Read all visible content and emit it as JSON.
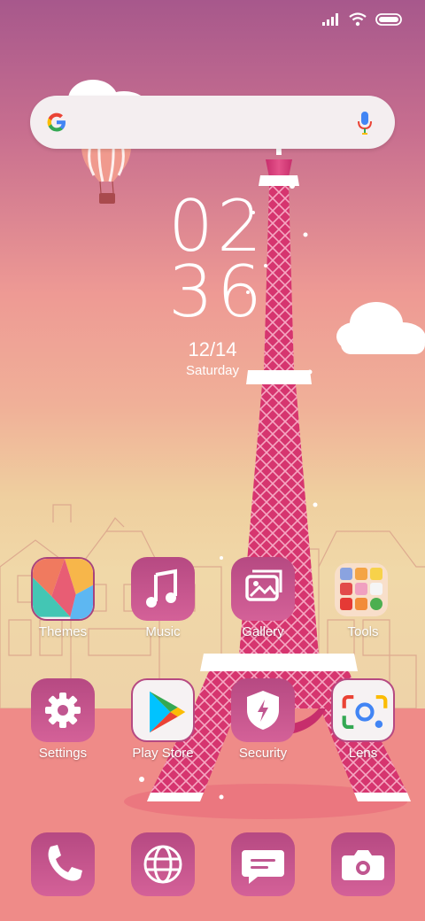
{
  "clock": {
    "hours": "02",
    "minutes": "36",
    "date": "12/14",
    "weekday": "Saturday"
  },
  "search": {
    "provider_icon": "google-g-icon",
    "voice_icon": "mic-icon"
  },
  "status_bar": {
    "icons": [
      "signal-icon",
      "wifi-icon",
      "battery-icon"
    ]
  },
  "apps_row1": [
    {
      "label": "Themes",
      "icon": "themes-icon"
    },
    {
      "label": "Music",
      "icon": "music-note-icon"
    },
    {
      "label": "Gallery",
      "icon": "gallery-icon"
    },
    {
      "label": "Tools",
      "icon": "folder-icon"
    }
  ],
  "apps_row2": [
    {
      "label": "Settings",
      "icon": "gear-icon"
    },
    {
      "label": "Play Store",
      "icon": "play-store-icon"
    },
    {
      "label": "Security",
      "icon": "shield-bolt-icon"
    },
    {
      "label": "Lens",
      "icon": "lens-icon"
    }
  ],
  "dock": [
    {
      "icon": "phone-icon"
    },
    {
      "icon": "browser-globe-icon"
    },
    {
      "icon": "messages-icon"
    },
    {
      "icon": "camera-icon"
    }
  ],
  "colors": {
    "icon_top": "#b84a83",
    "icon_bottom": "#c85a95",
    "accent_pink": "#e0457f",
    "tower": "#de3f7d"
  }
}
